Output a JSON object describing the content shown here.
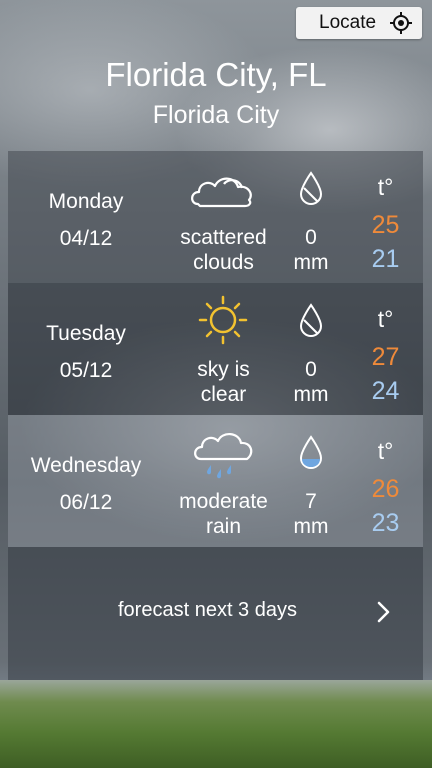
{
  "header": {
    "locate_label": "Locate",
    "city_main": "Florida City, FL",
    "city_sub": "Florida City"
  },
  "days": [
    {
      "name": "Monday",
      "date": "04/12",
      "condition_line1": "scattered",
      "condition_line2": "clouds",
      "icon": "cloud-icon",
      "precip_value": "0",
      "precip_unit": "mm",
      "temp_label": "t°",
      "high": "25",
      "low": "21"
    },
    {
      "name": "Tuesday",
      "date": "05/12",
      "condition_line1": "sky is",
      "condition_line2": "clear",
      "icon": "sun-icon",
      "precip_value": "0",
      "precip_unit": "mm",
      "temp_label": "t°",
      "high": "27",
      "low": "24"
    },
    {
      "name": "Wednesday",
      "date": "06/12",
      "condition_line1": "moderate",
      "condition_line2": "rain",
      "icon": "rain-cloud-icon",
      "precip_value": "7",
      "precip_unit": "mm",
      "temp_label": "t°",
      "high": "26",
      "low": "23"
    }
  ],
  "footer": {
    "forecast_label": "forecast next 3 days"
  },
  "colors": {
    "high_temp": "#ef8a3a",
    "low_temp": "#a8ccf0",
    "sun": "#f2c230",
    "rain_drop": "#6fa6e0"
  }
}
